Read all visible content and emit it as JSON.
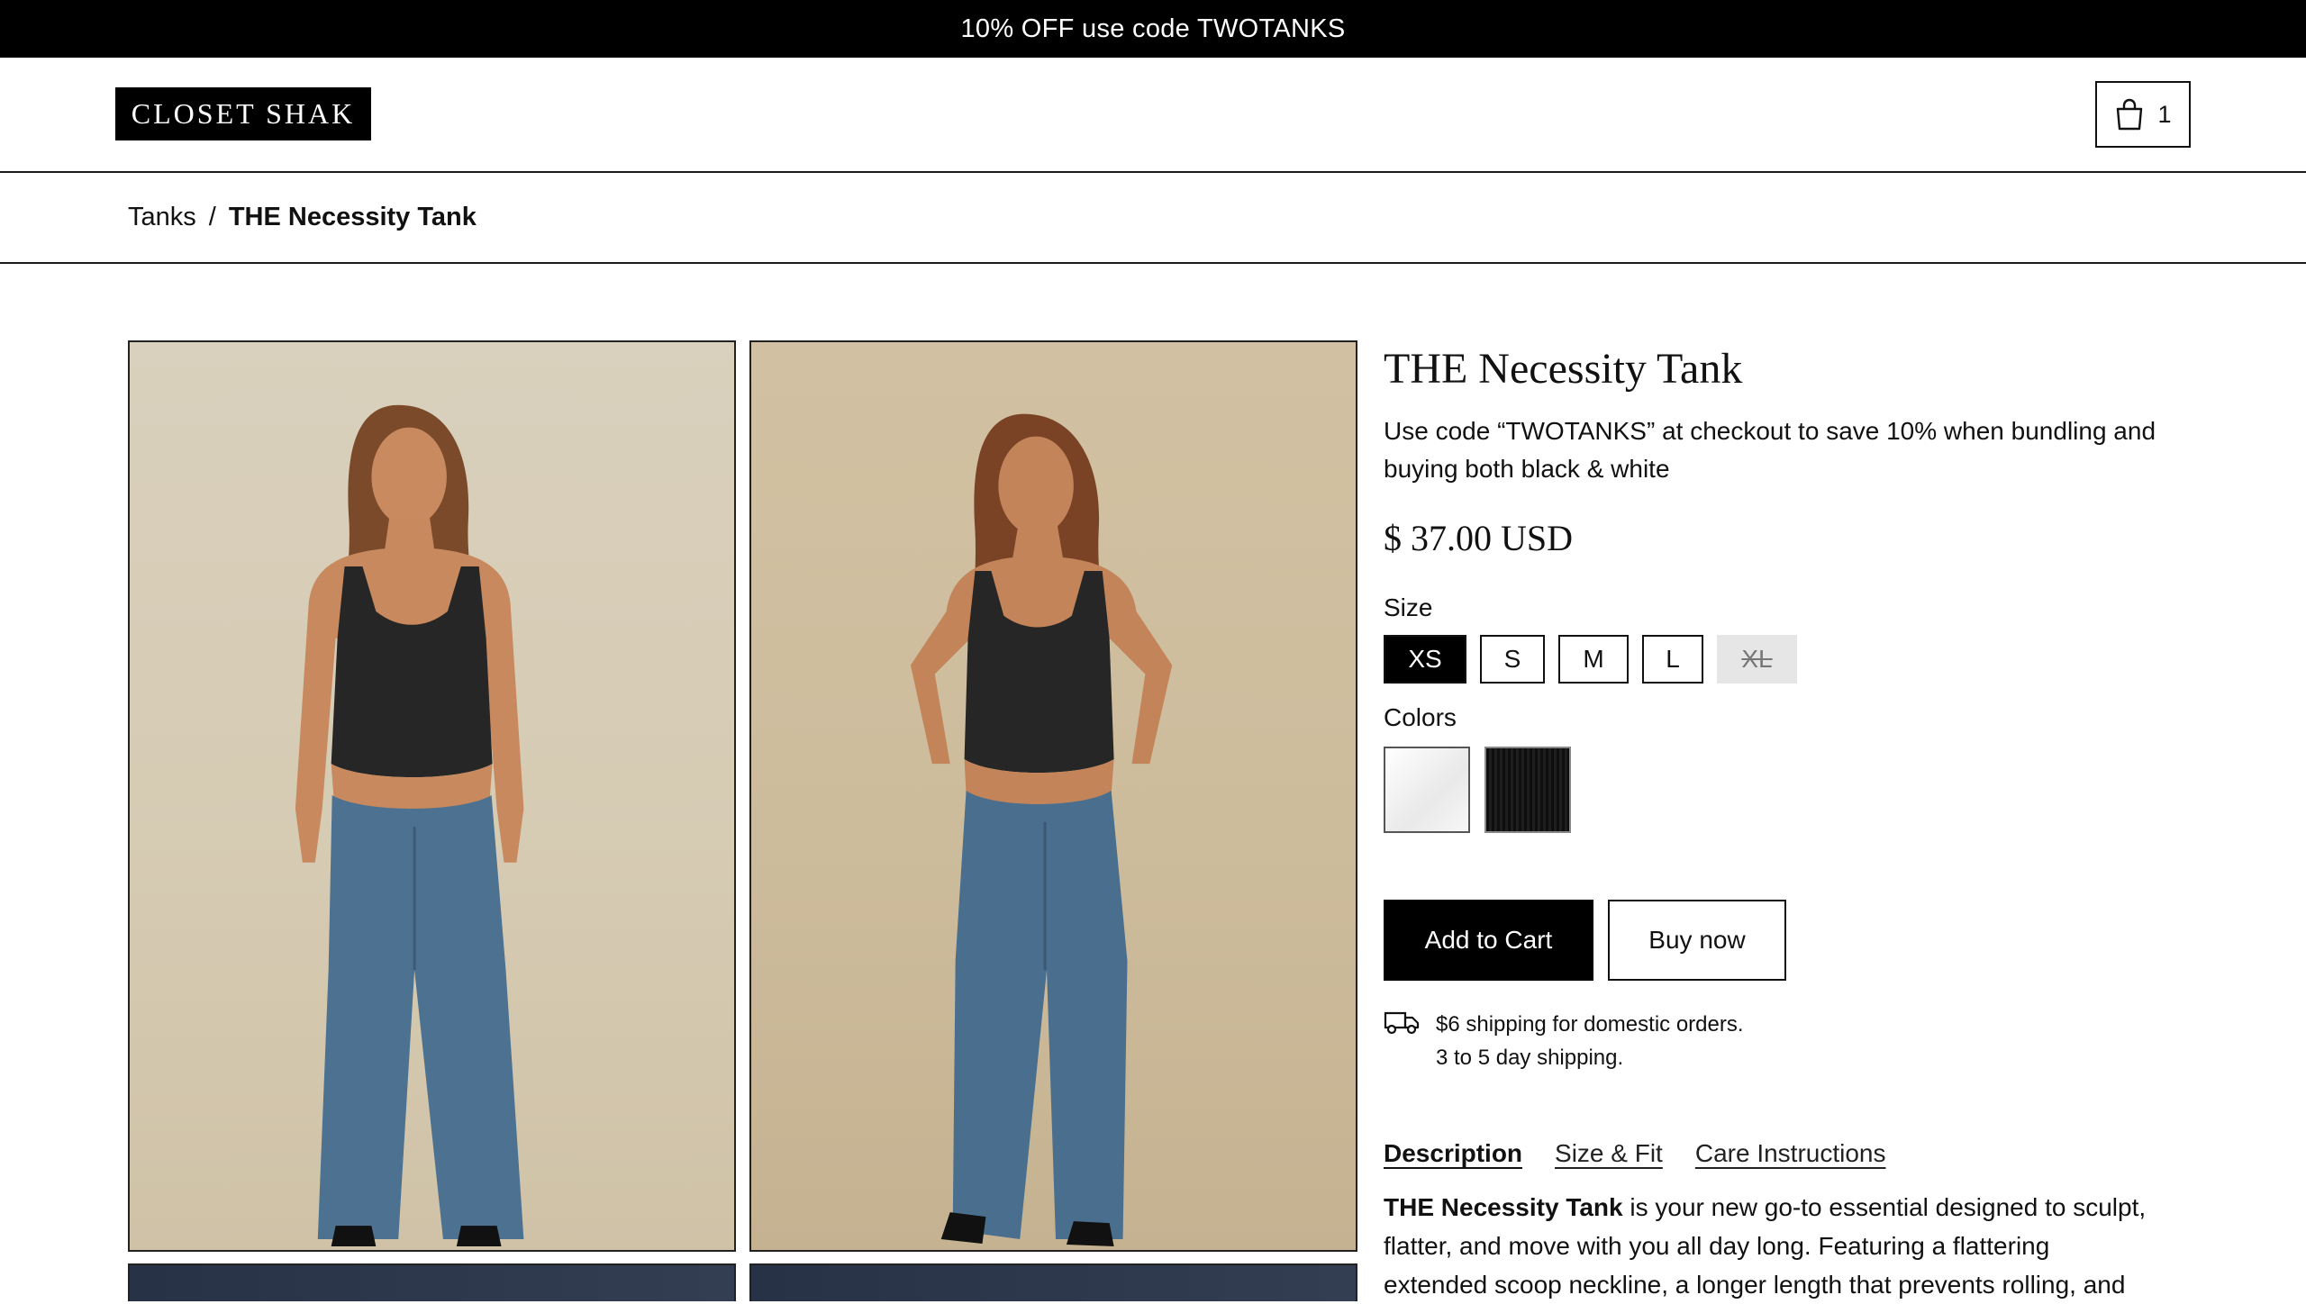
{
  "announcement": "10% OFF use code TWOTANKS",
  "header": {
    "logo": "CLOSET SHAK",
    "cart_count": "1"
  },
  "breadcrumb": {
    "parent": "Tanks",
    "separator": "/",
    "current": "THE Necessity Tank"
  },
  "product": {
    "title": "THE Necessity Tank",
    "promo": "Use code “TWOTANKS” at checkout to save 10% when bundling and buying both black & white",
    "price": "$ 37.00 USD",
    "size_label": "Size",
    "sizes": [
      {
        "label": "XS",
        "state": "selected"
      },
      {
        "label": "S",
        "state": "available"
      },
      {
        "label": "M",
        "state": "available"
      },
      {
        "label": "L",
        "state": "available"
      },
      {
        "label": "XL",
        "state": "sold-out"
      }
    ],
    "colors_label": "Colors",
    "colors": [
      {
        "name": "white",
        "hex": "#f4f4f4"
      },
      {
        "name": "black",
        "hex": "#141414"
      }
    ],
    "add_to_cart": "Add to Cart",
    "buy_now": "Buy now",
    "shipping": {
      "icon": "truck-icon",
      "line1": "$6 shipping for domestic orders.",
      "line2": "3 to 5 day shipping."
    },
    "tabs": [
      {
        "label": "Description",
        "active": true
      },
      {
        "label": "Size & Fit",
        "active": false
      },
      {
        "label": "Care Instructions",
        "active": false
      }
    ],
    "description": {
      "bold": "THE Necessity Tank",
      "text": " is your new go-to essential designed to sculpt, flatter, and move with you all day long. Featuring a flattering extended scoop neckline, a longer length that prevents rolling, and"
    }
  },
  "colors": {
    "accent": "#000000",
    "background": "#ffffff",
    "disabled": "#e6e6e6"
  }
}
